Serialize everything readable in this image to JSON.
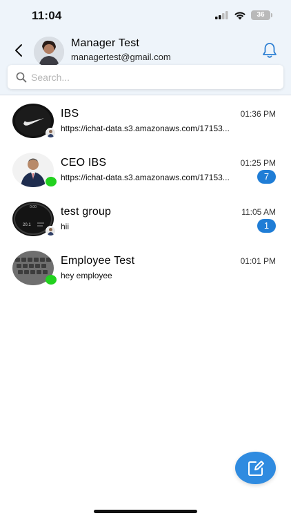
{
  "status_bar": {
    "time": "11:04",
    "battery": "36"
  },
  "header": {
    "name": "Manager Test",
    "email": "managertest@gmail.com"
  },
  "search": {
    "placeholder": "Search..."
  },
  "chats": [
    {
      "name": "IBS",
      "preview": "https://ichat-data.s3.amazonaws.com/17153...",
      "time": "01:36 PM",
      "unread": null,
      "indicator": "member-avatar"
    },
    {
      "name": "CEO IBS",
      "preview": "https://ichat-data.s3.amazonaws.com/17153...",
      "time": "01:25 PM",
      "unread": "7",
      "indicator": "online"
    },
    {
      "name": "test group",
      "preview": "hii",
      "time": "11:05 AM",
      "unread": "1",
      "indicator": "member-avatar"
    },
    {
      "name": "Employee Test",
      "preview": "hey employee",
      "time": "01:01 PM",
      "unread": null,
      "indicator": "online"
    }
  ],
  "colors": {
    "accent": "#1f7dd6",
    "online": "#22d11f",
    "header_bg": "#eef4fa"
  },
  "icons": [
    "back-arrow-icon",
    "bell-icon",
    "search-icon",
    "compose-icon"
  ]
}
